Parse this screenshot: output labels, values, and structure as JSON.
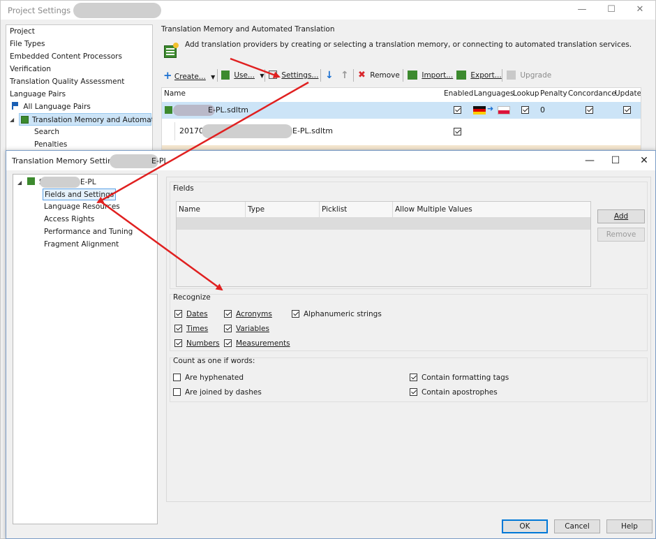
{
  "background_window": {
    "title": "Project Settings - 201",
    "tree": [
      "Project",
      "File Types",
      "Embedded Content Processors",
      "Verification",
      "Translation Quality Assessment",
      "Language Pairs",
      "All Language Pairs",
      "Translation Memory and Automated",
      "Search",
      "Penalties"
    ],
    "section_title": "Translation Memory and Automated Translation",
    "info_text": "Add translation providers by creating or selecting a translation memory, or connecting to automated translation services.",
    "toolbar": {
      "create": "Create...",
      "use": "Use...",
      "settings": "Settings...",
      "remove": "Remove",
      "import": "Import...",
      "export": "Export...",
      "upgrade": "Upgrade"
    },
    "grid": {
      "headers": [
        "Name",
        "Enabled",
        "Languages",
        "Lookup",
        "Penalty",
        "Concordance",
        "Update"
      ],
      "rows": [
        {
          "name": "E-PL.sdltm",
          "enabled": true,
          "lookup": true,
          "penalty": "0",
          "concordance": true,
          "update": true
        },
        {
          "name": "2017042",
          "name_suffix": "E-PL.sdltm",
          "enabled": true
        }
      ]
    }
  },
  "dialog": {
    "title": "Translation Memory Settings",
    "title_suffix": "E-PL",
    "tree": {
      "root_prefix": "S",
      "root_suffix": "E-PL",
      "items": [
        "Fields and Settings",
        "Language Resources",
        "Access Rights",
        "Performance and Tuning",
        "Fragment Alignment"
      ]
    },
    "fields": {
      "group_title": "Fields",
      "columns": [
        "Name",
        "Type",
        "Picklist",
        "Allow Multiple Values"
      ],
      "add_button": "Add",
      "remove_button": "Remove"
    },
    "recognize": {
      "group_title": "Recognize",
      "options": [
        {
          "label": "Dates",
          "checked": true
        },
        {
          "label": "Acronyms",
          "checked": true
        },
        {
          "label": "Alphanumeric strings",
          "checked": true
        },
        {
          "label": "Times",
          "checked": true
        },
        {
          "label": "Variables",
          "checked": true
        },
        {
          "label": "Numbers",
          "checked": true
        },
        {
          "label": "Measurements",
          "checked": true
        }
      ]
    },
    "count_as_one": {
      "group_title": "Count as one if words:",
      "options": [
        {
          "label": "Are hyphenated",
          "checked": false
        },
        {
          "label": "Contain formatting tags",
          "checked": true
        },
        {
          "label": "Are joined by dashes",
          "checked": false
        },
        {
          "label": "Contain apostrophes",
          "checked": true
        }
      ]
    },
    "buttons": {
      "ok": "OK",
      "cancel": "Cancel",
      "help": "Help"
    }
  },
  "colors": {
    "annotation_arrow": "#e02020",
    "selection": "#cce4f7",
    "accent": "#0078d7"
  }
}
